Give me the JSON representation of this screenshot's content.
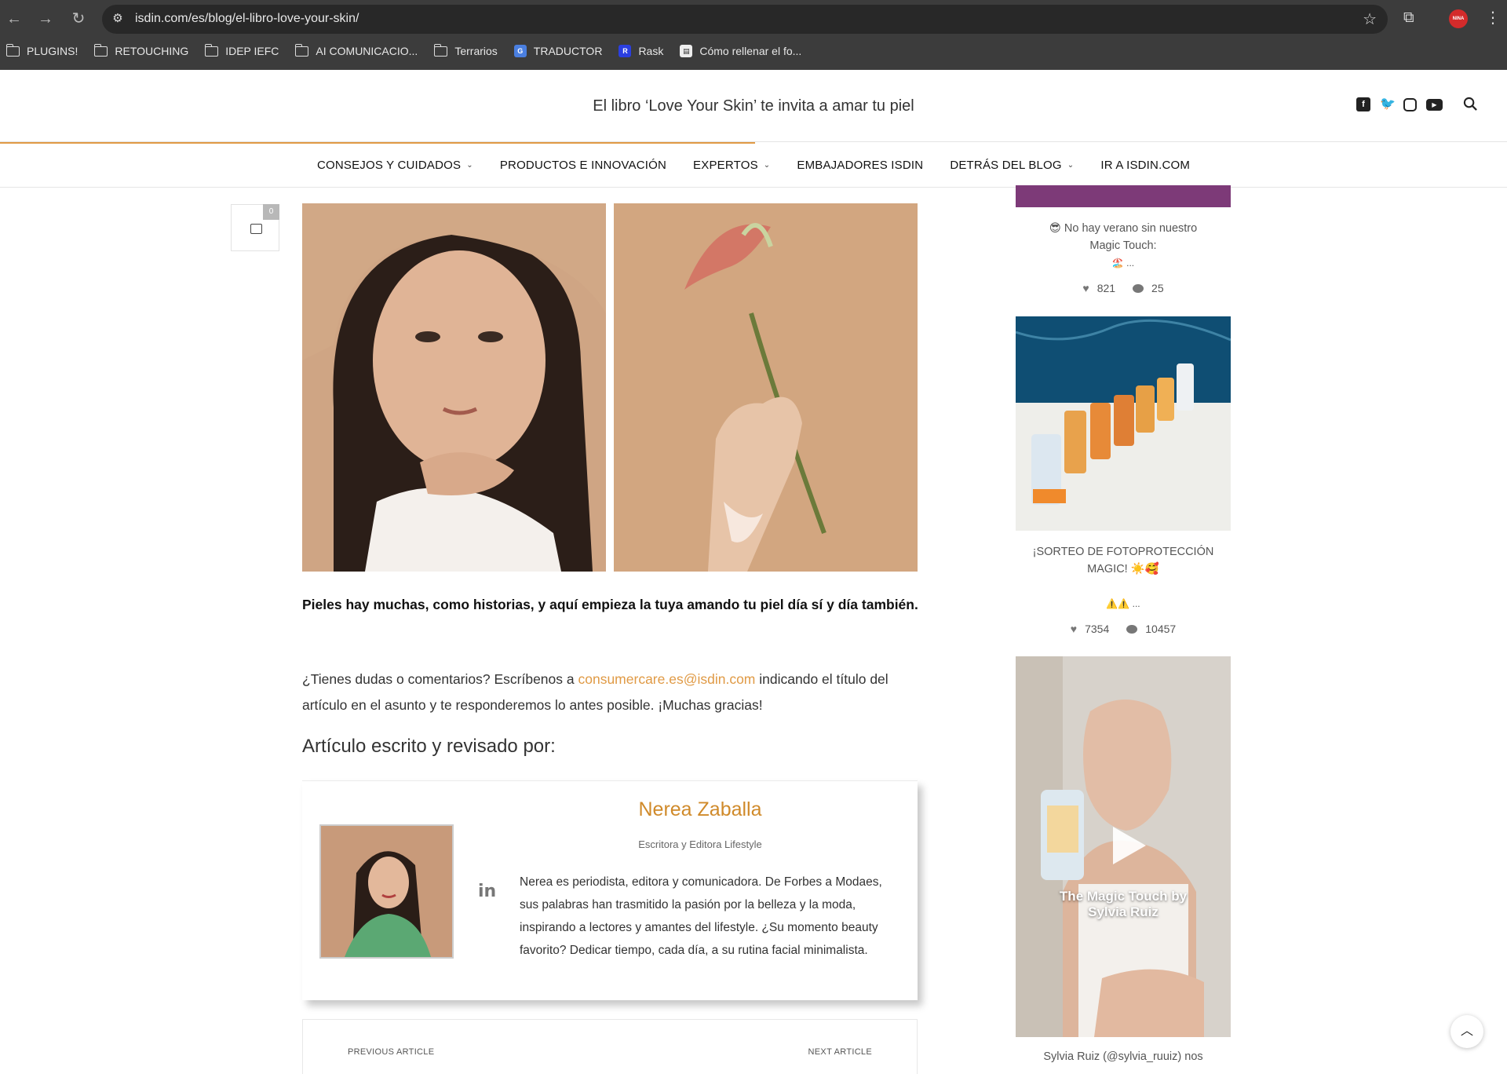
{
  "browser": {
    "url": "isdin.com/es/blog/el-libro-love-your-skin/",
    "profile_label": "NINA",
    "bookmarks": [
      {
        "label": "PLUGINS!",
        "icon": "folder-icon"
      },
      {
        "label": "RETOUCHING",
        "icon": "folder-icon"
      },
      {
        "label": "IDEP IEFC",
        "icon": "folder-icon"
      },
      {
        "label": "AI COMUNICACIO...",
        "icon": "folder-icon"
      },
      {
        "label": "Terrarios",
        "icon": "folder-icon"
      },
      {
        "label": "TRADUCTOR",
        "icon": "translate-icon"
      },
      {
        "label": "Rask",
        "icon": "rask-icon"
      },
      {
        "label": "Cómo rellenar el fo...",
        "icon": "doc-icon"
      }
    ]
  },
  "header": {
    "title": "El libro ‘Love Your Skin’ te invita a amar tu piel",
    "social": [
      "facebook-icon",
      "twitter-icon",
      "instagram-icon",
      "youtube-icon"
    ]
  },
  "nav": [
    {
      "label": "CONSEJOS Y CUIDADOS",
      "dropdown": true
    },
    {
      "label": "PRODUCTOS E INNOVACIÓN",
      "dropdown": false
    },
    {
      "label": "EXPERTOS",
      "dropdown": true
    },
    {
      "label": "EMBAJADORES ISDIN",
      "dropdown": false
    },
    {
      "label": "DETRÁS DEL BLOG",
      "dropdown": true
    },
    {
      "label": "IR A ISDIN.COM",
      "dropdown": false
    }
  ],
  "article": {
    "comment_count": "0",
    "lead": "Pieles hay muchas, como historias, y aquí empieza la tuya amando tu piel día sí y día también.",
    "para_before": "¿Tienes dudas o comentarios? Escríbenos a ",
    "email": "consumercare.es@isdin.com",
    "para_after": " indicando el título del artículo en el asunto y te responderemos lo antes posible. ¡Muchas gracias!",
    "written_by": "Artículo escrito y revisado por:"
  },
  "author": {
    "name": "Nerea Zaballa",
    "role": "Escritora y Editora Lifestyle",
    "bio": "Nerea es periodista, editora y comunicadora. De Forbes a Modaes, sus palabras han trasmitido la pasión por la belleza y la moda, inspirando a lectores y amantes del lifestyle. ¿Su momento beauty favorito? Dedicar tiempo, cada día, a su rutina facial minimalista.",
    "linkedin": "in"
  },
  "article_nav": {
    "prev": "PREVIOUS ARTICLE",
    "next": "NEXT ARTICLE"
  },
  "sidebar": {
    "post1": {
      "caption_line1": "😎 No hay verano sin nuestro",
      "caption_line2": "Magic Touch:",
      "caption_line3": "🏖️ ...",
      "likes": "821",
      "comments": "25"
    },
    "post2": {
      "caption_line1": "¡SORTEO DE FOTOPROTECCIÓN",
      "caption_line2": "MAGIC! ☀️🥰",
      "caption_line3": "⚠️⚠️ ...",
      "likes": "7354",
      "comments": "10457"
    },
    "post3": {
      "overlay": "The Magic Touch by Sylvia Ruiz",
      "caption_line1": "Sylvia Ruiz (@sylvia_ruuiz) nos"
    }
  },
  "colors": {
    "accent": "#e09a45",
    "author_name": "#d08a2a",
    "chrome": "#3c3c3c"
  }
}
